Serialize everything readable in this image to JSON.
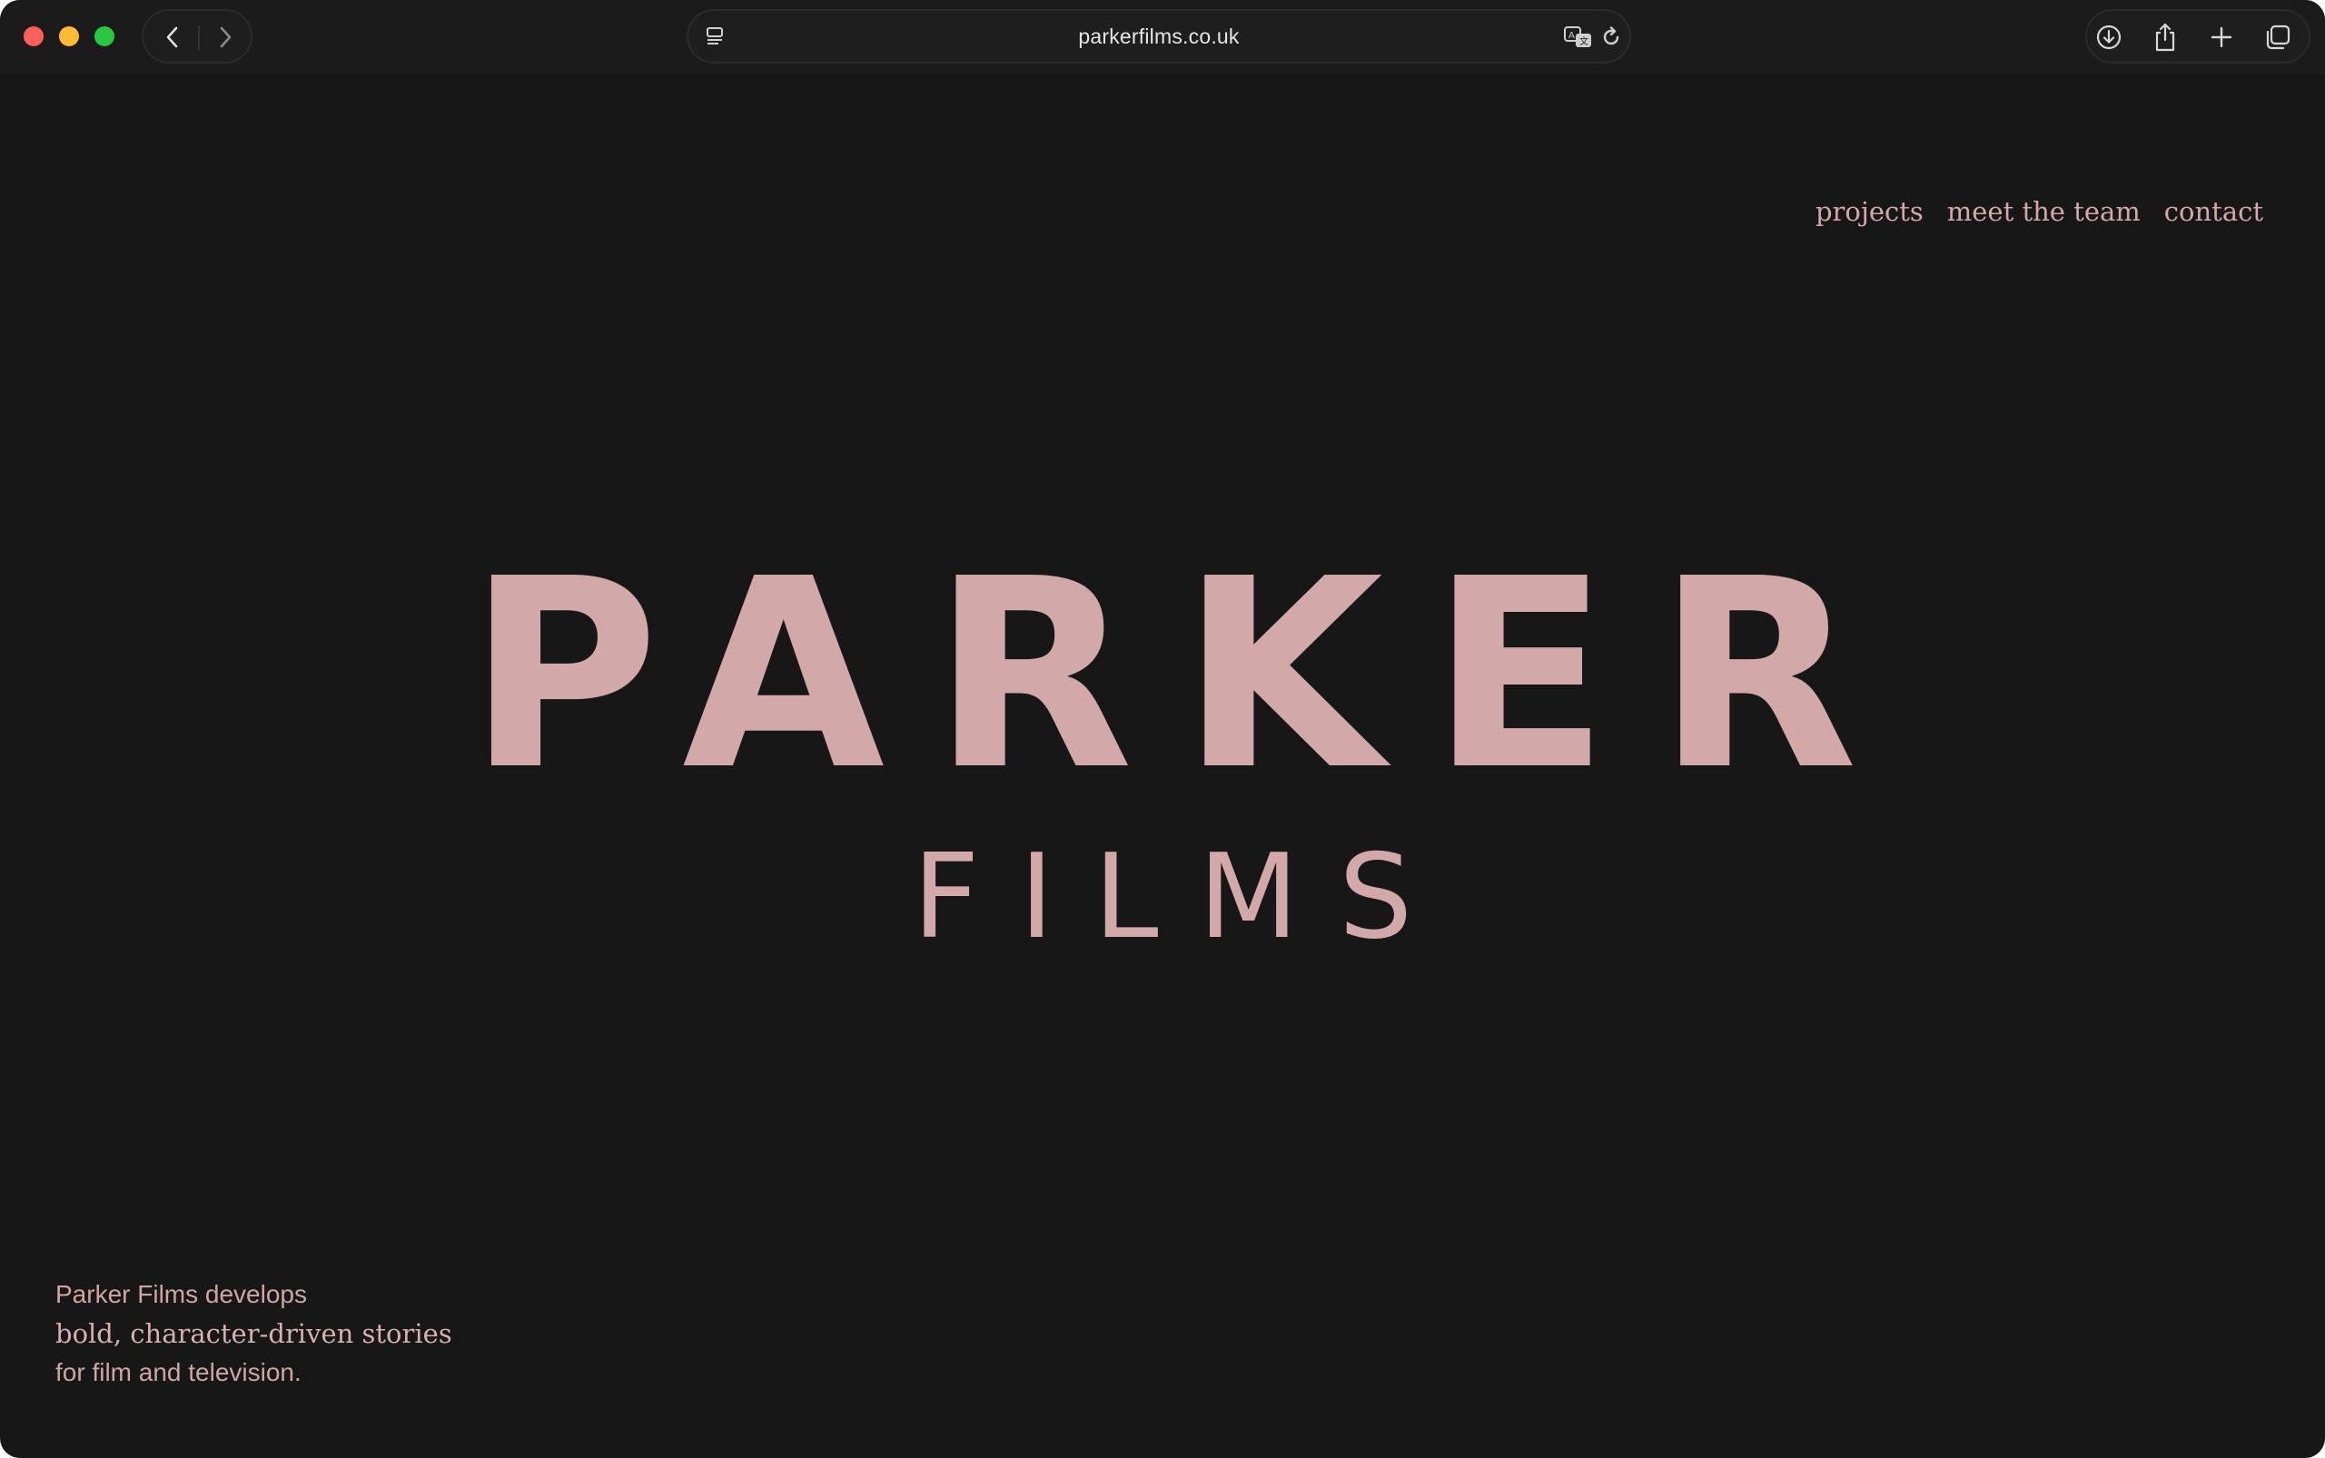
{
  "browser": {
    "url": "parkerfilms.co.uk",
    "icons": {
      "close": "close-traffic-light",
      "minimize": "minimize-traffic-light",
      "maximize": "maximize-traffic-light",
      "back": "chevron-left-icon",
      "forward": "chevron-right-icon",
      "reader": "reader-icon",
      "translate": "translate-icon",
      "reload": "reload-icon",
      "download": "download-icon",
      "share": "share-icon",
      "new_tab": "plus-icon",
      "tab_overview": "tabs-icon"
    },
    "colors": {
      "close": "#fe5f57",
      "minimize": "#febc2e",
      "maximize": "#28c840"
    }
  },
  "site": {
    "nav": [
      {
        "label": "projects"
      },
      {
        "label": "meet the team"
      },
      {
        "label": "contact"
      }
    ],
    "logo": {
      "main": "PARKER",
      "sub": "FILMS"
    },
    "tagline": {
      "line1": "Parker Films develops",
      "line2": "bold, character-driven stories",
      "line3": "for film and television."
    },
    "colors": {
      "background": "#171717",
      "accent": "#d3a8a8"
    }
  }
}
